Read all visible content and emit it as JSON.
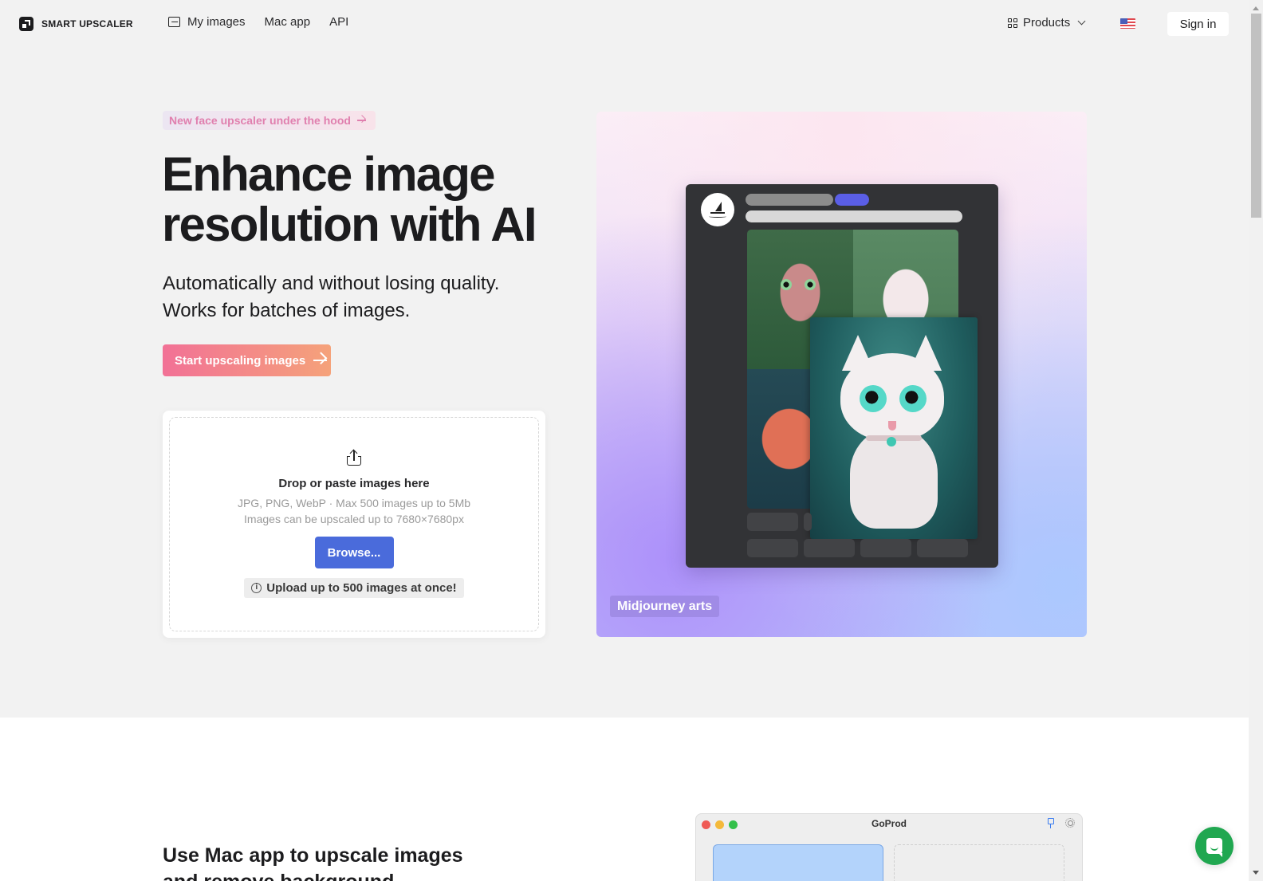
{
  "header": {
    "brand": "SMART UPSCALER",
    "nav": [
      {
        "label": "My images",
        "icon": "image-icon"
      },
      {
        "label": "Mac app"
      },
      {
        "label": "API"
      }
    ],
    "products_label": "Products",
    "language_flag": "us-flag",
    "signin_label": "Sign in"
  },
  "hero": {
    "badge": "New face upscaler under the hood",
    "headline": "Enhance image resolution with AI",
    "sub_line1": "Automatically and without losing quality.",
    "sub_line2": "Works for batches of images.",
    "cta_label": "Start upscaling images",
    "accent_gradient": [
      "#f27196",
      "#f5a27a"
    ]
  },
  "upload": {
    "title": "Drop or paste images here",
    "hint_formats": "JPG, PNG, WebP · Max 500 images up to 5Mb",
    "hint_size": "Images can be upscaled up to 7680×7680px",
    "browse_label": "Browse...",
    "notice": "Upload up to 500 images at once!",
    "browse_color": "#4a6bdb"
  },
  "showcase": {
    "caption": "Midjourney arts",
    "mock_app": "Midjourney"
  },
  "section2": {
    "title": "Use Mac app to upscale images and remove background",
    "mac_window_title": "GoProd"
  },
  "chat": {
    "icon": "chat-icon",
    "color": "#20a750"
  }
}
